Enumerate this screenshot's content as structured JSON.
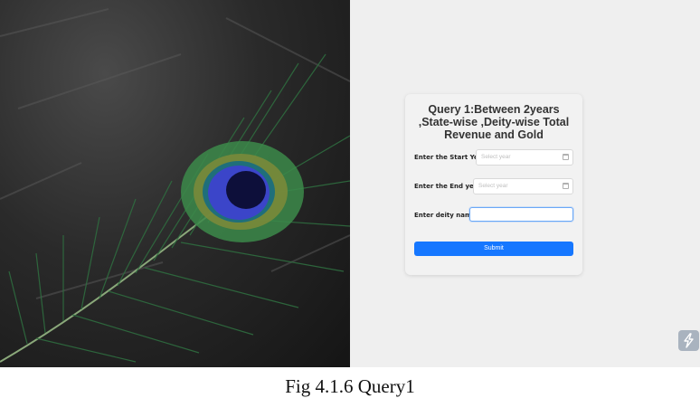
{
  "form": {
    "title": "Query 1:Between 2years ,State-wise ,Deity-wise Total Revenue and Gold",
    "start_year": {
      "label": "Enter the Start Year:",
      "placeholder": "Select year"
    },
    "end_year": {
      "label": "Enter the End year:",
      "placeholder": "Select year"
    },
    "deity": {
      "label": "Enter deity name:",
      "value": ""
    },
    "submit_label": "Submit",
    "accent_color": "#1677ff"
  },
  "hero": {
    "image": "peacock-feather",
    "icon": "calendar-icon"
  },
  "floating_button": {
    "icon": "lightning-icon"
  },
  "caption": "Fig 4.1.6 Query1"
}
